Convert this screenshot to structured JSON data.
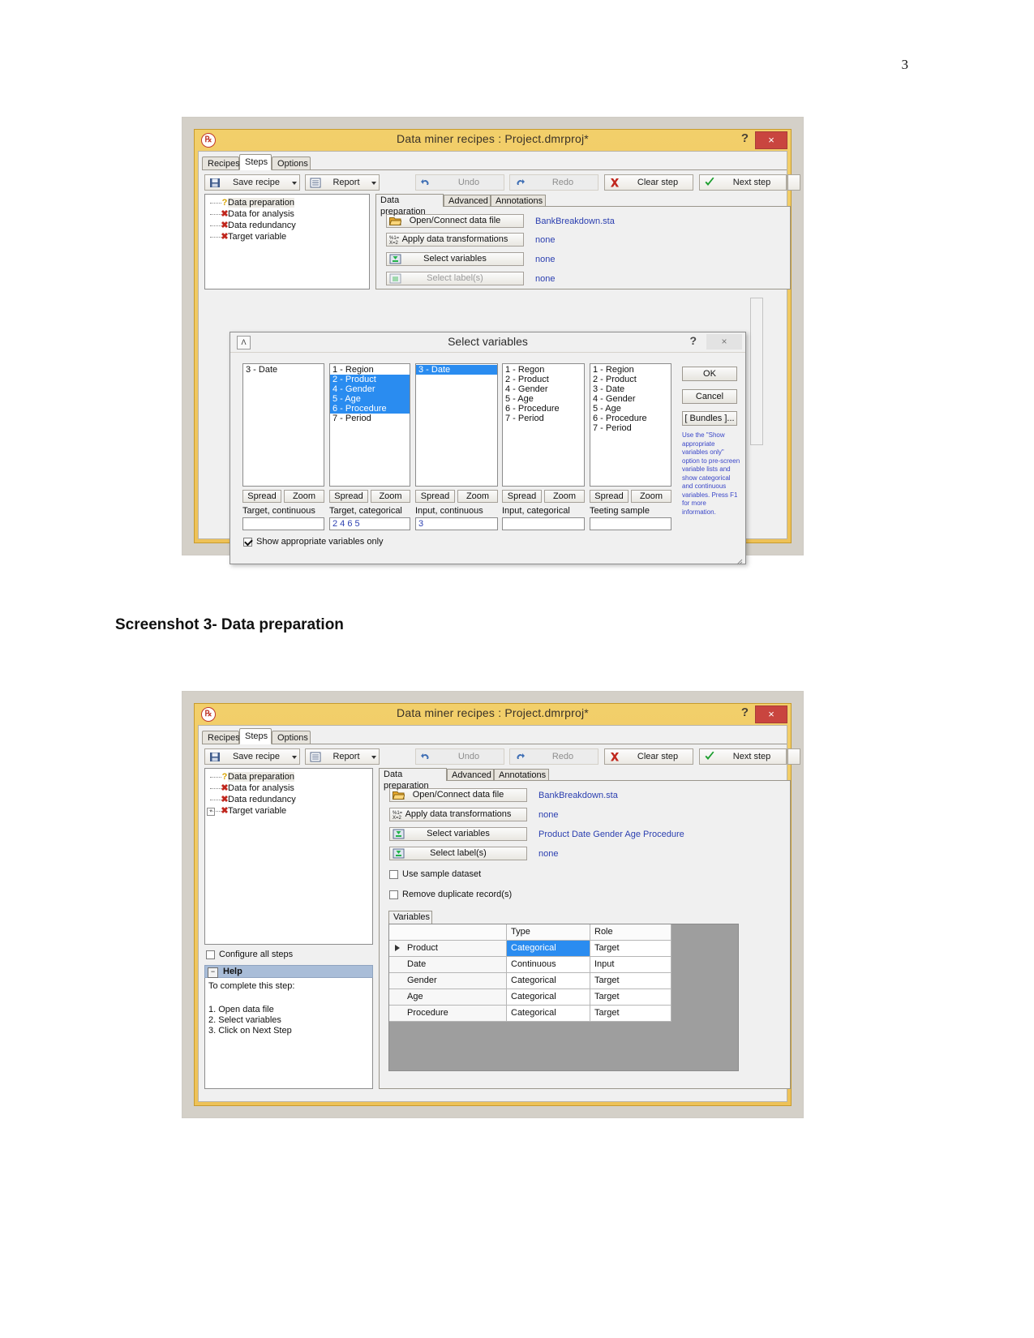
{
  "page": {
    "number": "3",
    "caption": "Screenshot 3- Data preparation"
  },
  "window": {
    "title": "Data miner recipes : Project.dmrproj*",
    "app_icon": "statistica-icon",
    "help_label": "?",
    "close_label": "×",
    "tabs": [
      {
        "label": "Recipes",
        "active": false
      },
      {
        "label": "Steps",
        "active": true
      },
      {
        "label": "Options",
        "active": false
      }
    ],
    "toolbar": [
      {
        "label": "Save recipe",
        "icon": "save-icon",
        "enabled": true,
        "dropdown": true
      },
      {
        "label": "Report",
        "icon": "report-icon",
        "enabled": true,
        "dropdown": true
      },
      {
        "label": "Undo",
        "icon": "undo-icon",
        "enabled": false,
        "dropdown": false
      },
      {
        "label": "Redo",
        "icon": "redo-icon",
        "enabled": false,
        "dropdown": false
      },
      {
        "label": "Clear step",
        "icon": "red-x-icon",
        "enabled": true,
        "dropdown": false
      },
      {
        "label": "Next step",
        "icon": "green-check-icon",
        "enabled": true,
        "dropdown": true
      }
    ],
    "tree": [
      {
        "label": "Data preparation",
        "icon": "question-icon",
        "selected": true,
        "expandable": false
      },
      {
        "label": "Data for analysis",
        "icon": "red-x-icon",
        "selected": false,
        "expandable": false
      },
      {
        "label": "Data redundancy",
        "icon": "red-x-icon",
        "selected": false,
        "expandable": false
      },
      {
        "label": "Target variable",
        "icon": "red-x-icon",
        "selected": false,
        "expandable": false
      }
    ],
    "pane_tabs": [
      {
        "label": "Data preparation",
        "active": true
      },
      {
        "label": "Advanced",
        "active": false
      },
      {
        "label": "Annotations",
        "active": false
      }
    ],
    "steps": [
      {
        "label": "Open/Connect data file",
        "icon": "open-folder-icon",
        "value": "BankBreakdown.sta",
        "enabled": true
      },
      {
        "label": "Apply data transformations",
        "icon": "transform-icon",
        "value": "none",
        "enabled": true
      },
      {
        "label": "Select variables",
        "icon": "select-vars-icon",
        "value": "none",
        "enabled": true
      },
      {
        "label": "Select label(s)",
        "icon": "select-vars-icon",
        "value": "none",
        "enabled": false
      }
    ]
  },
  "select_variables_dialog": {
    "title": "Select variables",
    "dialog_icon": "variables-icon",
    "help_label": "?",
    "close_label": "×",
    "columns": [
      {
        "caption": "Target, continuous",
        "items": [
          {
            "label": "3 - Date",
            "selected": false
          }
        ],
        "spread_label": "Spread",
        "zoom_label": "Zoom",
        "value": ""
      },
      {
        "caption": "Target, categorical",
        "items": [
          {
            "label": "1 - Region",
            "selected": false
          },
          {
            "label": "2 - Product",
            "selected": true
          },
          {
            "label": "4 - Gender",
            "selected": true
          },
          {
            "label": "5 - Age",
            "selected": true
          },
          {
            "label": "6 - Procedure",
            "selected": true
          },
          {
            "label": "7 - Period",
            "selected": false
          }
        ],
        "spread_label": "Spread",
        "zoom_label": "Zoom",
        "value": "2 4 6 5"
      },
      {
        "caption": "Input, continuous",
        "items": [
          {
            "label": "3 - Date",
            "selected": true
          }
        ],
        "spread_label": "Spread",
        "zoom_label": "Zoom",
        "value": "3"
      },
      {
        "caption": "Input, categorical",
        "items": [
          {
            "label": "1 - Regon",
            "selected": false
          },
          {
            "label": "2 - Product",
            "selected": false
          },
          {
            "label": "4 - Gender",
            "selected": false
          },
          {
            "label": "5 - Age",
            "selected": false
          },
          {
            "label": "6 - Procedure",
            "selected": false
          },
          {
            "label": "7 - Period",
            "selected": false
          }
        ],
        "spread_label": "Spread",
        "zoom_label": "Zoom",
        "value": ""
      },
      {
        "caption": "Teeting sample",
        "items": [
          {
            "label": "1 - Region",
            "selected": false
          },
          {
            "label": "2 - Product",
            "selected": false
          },
          {
            "label": "3 - Date",
            "selected": false
          },
          {
            "label": "4 - Gender",
            "selected": false
          },
          {
            "label": "5 - Age",
            "selected": false
          },
          {
            "label": "6 - Procedure",
            "selected": false
          },
          {
            "label": "7 - Period",
            "selected": false
          }
        ],
        "spread_label": "Spread",
        "zoom_label": "Zoom",
        "value": ""
      }
    ],
    "buttons": {
      "ok": "OK",
      "cancel": "Cancel",
      "bundles": "[ Bundles ]..."
    },
    "hint": "Use the \"Show appropriate variables only\" option to pre-screen variable lists and show categorical and continuous variables. Press F1 for more information.",
    "show_appropriate": {
      "label": "Show appropriate variables only",
      "checked": true
    }
  },
  "window2": {
    "title": "Data miner recipes : Project.dmrproj*",
    "tabs": [
      {
        "label": "Recipes",
        "active": false
      },
      {
        "label": "Steps",
        "active": true
      },
      {
        "label": "Options",
        "active": false
      }
    ],
    "toolbar": [
      {
        "label": "Save recipe",
        "icon": "save-icon",
        "enabled": true,
        "dropdown": true
      },
      {
        "label": "Report",
        "icon": "report-icon",
        "enabled": true,
        "dropdown": true
      },
      {
        "label": "Undo",
        "icon": "undo-icon",
        "enabled": false,
        "dropdown": false
      },
      {
        "label": "Redo",
        "icon": "redo-icon",
        "enabled": false,
        "dropdown": false
      },
      {
        "label": "Clear step",
        "icon": "red-x-icon",
        "enabled": true,
        "dropdown": false
      },
      {
        "label": "Next step",
        "icon": "green-check-icon",
        "enabled": true,
        "dropdown": true
      }
    ],
    "tree": [
      {
        "label": "Data preparation",
        "icon": "question-icon",
        "selected": true,
        "expandable": false
      },
      {
        "label": "Data for analysis",
        "icon": "red-x-icon",
        "selected": false,
        "expandable": false
      },
      {
        "label": "Data redundancy",
        "icon": "red-x-icon",
        "selected": false,
        "expandable": false
      },
      {
        "label": "Target variable",
        "icon": "red-x-icon",
        "selected": false,
        "expandable": true
      }
    ],
    "configure_all": {
      "label": "Configure all steps",
      "checked": false
    },
    "help": {
      "title": "Help",
      "collapse_label": "−",
      "intro": "To complete this step:",
      "items": [
        "1. Open data file",
        "2. Select variables",
        "3. Click on Next Step"
      ]
    },
    "pane_tabs": [
      {
        "label": "Data preparation",
        "active": true
      },
      {
        "label": "Advanced",
        "active": false
      },
      {
        "label": "Annotations",
        "active": false
      }
    ],
    "steps": [
      {
        "label": "Open/Connect data file",
        "icon": "open-folder-icon",
        "value": "BankBreakdown.sta",
        "enabled": true
      },
      {
        "label": "Apply data transformations",
        "icon": "transform-icon",
        "value": "none",
        "enabled": true
      },
      {
        "label": "Select variables",
        "icon": "select-vars-icon",
        "value": "Product Date Gender Age Procedure",
        "enabled": true
      },
      {
        "label": "Select label(s)",
        "icon": "select-vars-icon",
        "value": "none",
        "enabled": true
      }
    ],
    "checks": [
      {
        "label": "Use sample dataset",
        "checked": false
      },
      {
        "label": "Remove duplicate record(s)",
        "checked": false
      }
    ],
    "grid_tab": "Variables",
    "grid": {
      "headers": [
        "",
        "Type",
        "Role"
      ],
      "rows": [
        {
          "name": "Product",
          "type": "Categorical",
          "role": "Target",
          "current": true,
          "type_selected": true
        },
        {
          "name": "Date",
          "type": "Continuous",
          "role": "Input",
          "current": false,
          "type_selected": false
        },
        {
          "name": "Gender",
          "type": "Categorical",
          "role": "Target",
          "current": false,
          "type_selected": false
        },
        {
          "name": "Age",
          "type": "Categorical",
          "role": "Target",
          "current": false,
          "type_selected": false
        },
        {
          "name": "Procedure",
          "type": "Categorical",
          "role": "Target",
          "current": false,
          "type_selected": false
        }
      ]
    }
  },
  "colors": {
    "title_bar": "#eec257",
    "accent_blue": "#2a8cf0",
    "link_blue": "#2b3fb0",
    "error_red": "#c0261d",
    "close_red": "#c9453f"
  }
}
